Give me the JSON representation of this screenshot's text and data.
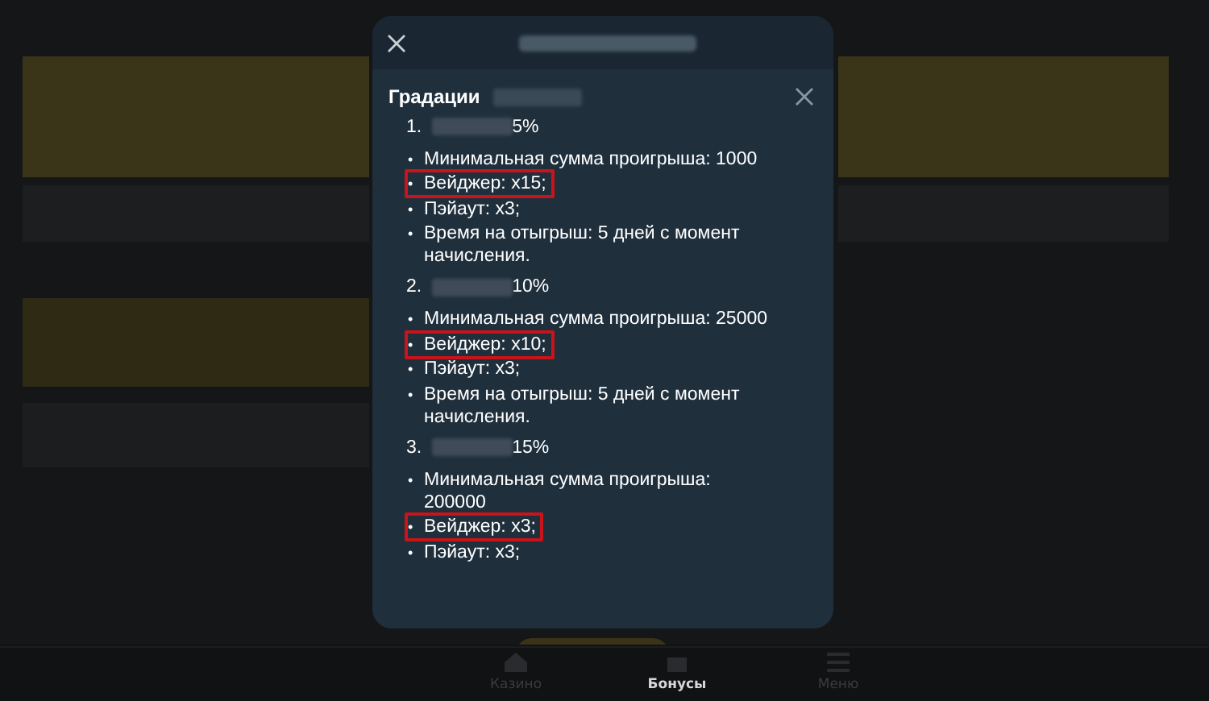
{
  "modal": {
    "card": {
      "title": "Градации",
      "tiers": [
        {
          "number": "1.",
          "value": "5%",
          "items": [
            {
              "bullet": "•",
              "text": "Минимальная сумма проигрыша: 1000",
              "highlighted": false
            },
            {
              "bullet": "•",
              "text": "Вейджер: x15;",
              "highlighted": true
            },
            {
              "bullet": "•",
              "text": "Пэйаут: x3;",
              "highlighted": false
            },
            {
              "bullet": "•",
              "text": "Время на отыгрыш: 5 дней с момент начисления.",
              "highlighted": false
            }
          ]
        },
        {
          "number": "2.",
          "value": "10%",
          "items": [
            {
              "bullet": "•",
              "text": "Минимальная сумма проигрыша: 25000",
              "highlighted": false
            },
            {
              "bullet": "•",
              "text": "Вейджер: x10;",
              "highlighted": true
            },
            {
              "bullet": "•",
              "text": "Пэйаут: x3;",
              "highlighted": false
            },
            {
              "bullet": "•",
              "text": "Время на отыгрыш: 5 дней с момент начисления.",
              "highlighted": false
            }
          ]
        },
        {
          "number": "3.",
          "value": "15%",
          "items": [
            {
              "bullet": "•",
              "text": "Минимальная сумма проигрыша: 200000",
              "highlighted": false
            },
            {
              "bullet": "•",
              "text": "Вейджер: x3;",
              "highlighted": true
            },
            {
              "bullet": "•",
              "text": "Пэйаут: x3;",
              "highlighted": false
            }
          ]
        }
      ]
    }
  },
  "bottom_nav": [
    {
      "label": "Казино",
      "selected": false
    },
    {
      "label": "Бонусы",
      "selected": true
    },
    {
      "label": "Меню",
      "selected": false
    }
  ]
}
